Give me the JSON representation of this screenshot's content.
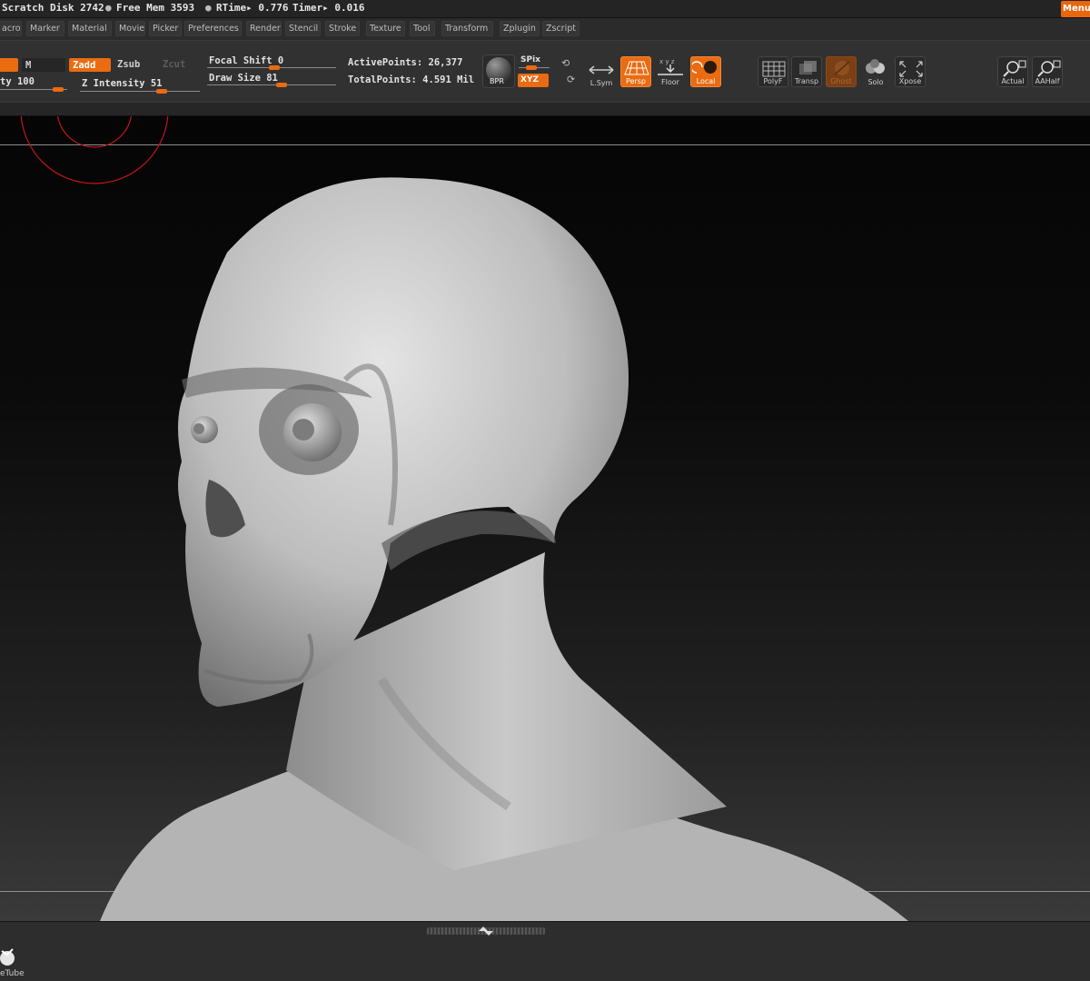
{
  "status": {
    "scratch_disk": "Scratch Disk 2742",
    "free_mem": "Free Mem 3593",
    "rtime": "RTime▸ 0.776",
    "timer": "Timer▸ 0.016",
    "bullet": "●",
    "menu_button": "Menu"
  },
  "menus": [
    "acro",
    "Marker",
    "Material",
    "Movie",
    "Picker",
    "Preferences",
    "Render",
    "Stencil",
    "Stroke",
    "Texture",
    "Tool",
    "Transform",
    "Zplugin",
    "Zscript"
  ],
  "shelf": {
    "m_label": "M",
    "zadd": "Zadd",
    "zsub": "Zsub",
    "zcut": "Zcut",
    "rgb_intensity": "ty 100",
    "z_intensity": "Z Intensity 51",
    "focal_shift": "Focal Shift 0",
    "draw_size": "Draw Size 81",
    "active_points": "ActivePoints: 26,377",
    "total_points": "TotalPoints: 4.591 Mil",
    "bpr": "BPR",
    "spix": "SPix",
    "xyz": "XYZ",
    "lsym": "L.Sym",
    "persp": "Persp",
    "floor": "Floor",
    "local": "Local",
    "polyf": "PolyF",
    "transp": "Transp",
    "ghost": "Ghost",
    "solo": "Solo",
    "xpose": "Xpose",
    "actual": "Actual",
    "aahalf": "AAHalf"
  },
  "tray": {
    "item_label": "eTube"
  },
  "colors": {
    "accent": "#ea6b10",
    "brush_cursor": "#c4161c"
  }
}
